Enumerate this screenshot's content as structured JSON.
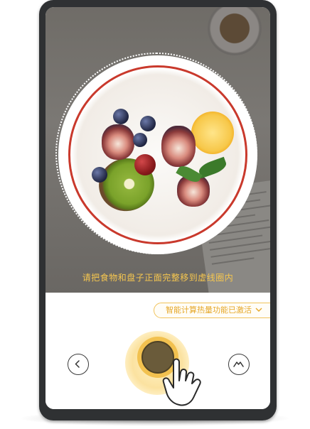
{
  "camera": {
    "hint_text": "请把食物和盘子正面完整移到虚线圈内"
  },
  "controls": {
    "feature_pill_label": "智能计算热量功能已激活",
    "feature_pill_icon": "chevron-down-icon",
    "back_icon": "chevron-left-icon",
    "mountain_icon": "mountain-icon",
    "shutter_icon": "shutter-button",
    "hand_icon": "tap-hand-icon"
  },
  "colors": {
    "accent": "#f2c14f",
    "plate_rim": "#c9392c",
    "device_frame": "#2f3133"
  }
}
